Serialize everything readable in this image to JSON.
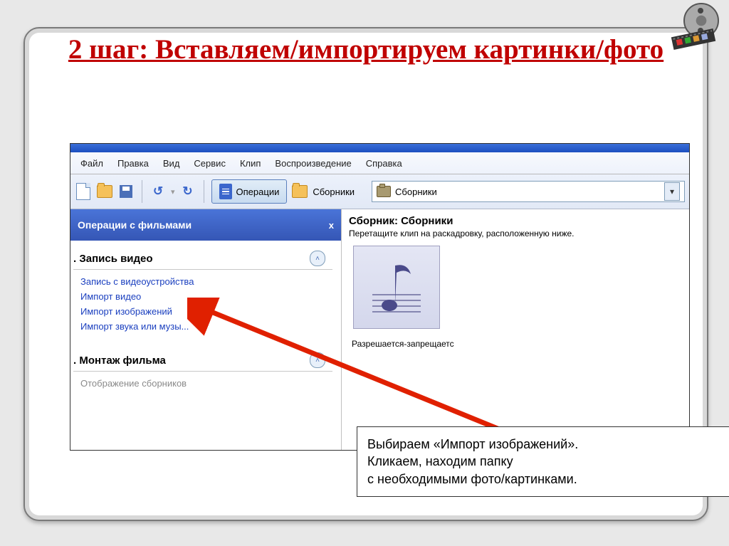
{
  "heading": "2 шаг: Вставляем/импортируем картинки/фото",
  "menubar": [
    "Файл",
    "Правка",
    "Вид",
    "Сервис",
    "Клип",
    "Воспроизведение",
    "Справка"
  ],
  "toolbar": {
    "operations": "Операции",
    "collections": "Сборники",
    "dropdown_value": "Сборники"
  },
  "task_pane": {
    "title": "Операции с фильмами",
    "close": "x",
    "section1": {
      "label": ". Запись видео",
      "chevron": "˄",
      "links": [
        "Запись с видеоустройства",
        "Импорт видео",
        "Импорт изображений",
        "Импорт звука или музы..."
      ]
    },
    "section2": {
      "label": ". Монтаж фильма",
      "chevron": "˄",
      "links": [
        "Отображение сборников"
      ]
    }
  },
  "content": {
    "title": "Сборник: Сборники",
    "hint": "Перетащите клип на раскадровку, расположенную ниже.",
    "thumb_label": "Разрешается-запрещаетс"
  },
  "callout": {
    "line1": "Выбираем «Импорт изображений».",
    "line2": "Кликаем, находим папку",
    "line3": "с необходимыми фото/картинками."
  }
}
